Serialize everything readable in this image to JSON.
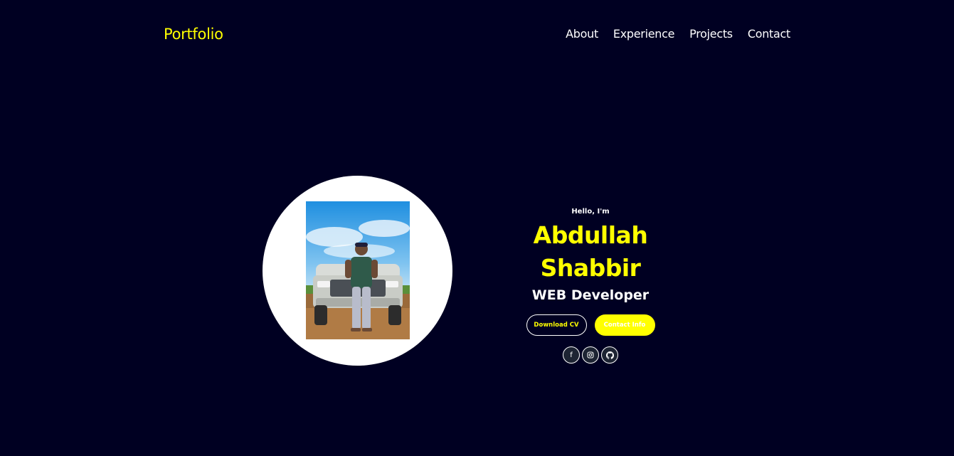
{
  "header": {
    "logo": "Portfolio",
    "nav": [
      {
        "label": "About"
      },
      {
        "label": "Experience"
      },
      {
        "label": "Projects"
      },
      {
        "label": "Contact"
      }
    ]
  },
  "hero": {
    "greeting": "Hello, I'm",
    "name": "Abdullah Shabbir",
    "role": "WEB Developer",
    "buttons": {
      "download_cv": "Download CV",
      "contact_info": "Contact Info"
    },
    "socials": [
      {
        "icon": "facebook-icon",
        "glyph": "f"
      },
      {
        "icon": "instagram-icon",
        "glyph": "◎"
      },
      {
        "icon": "github-icon",
        "glyph": "●"
      }
    ]
  },
  "colors": {
    "background": "#000022",
    "accent": "#ffff00",
    "text": "#ffffff"
  }
}
